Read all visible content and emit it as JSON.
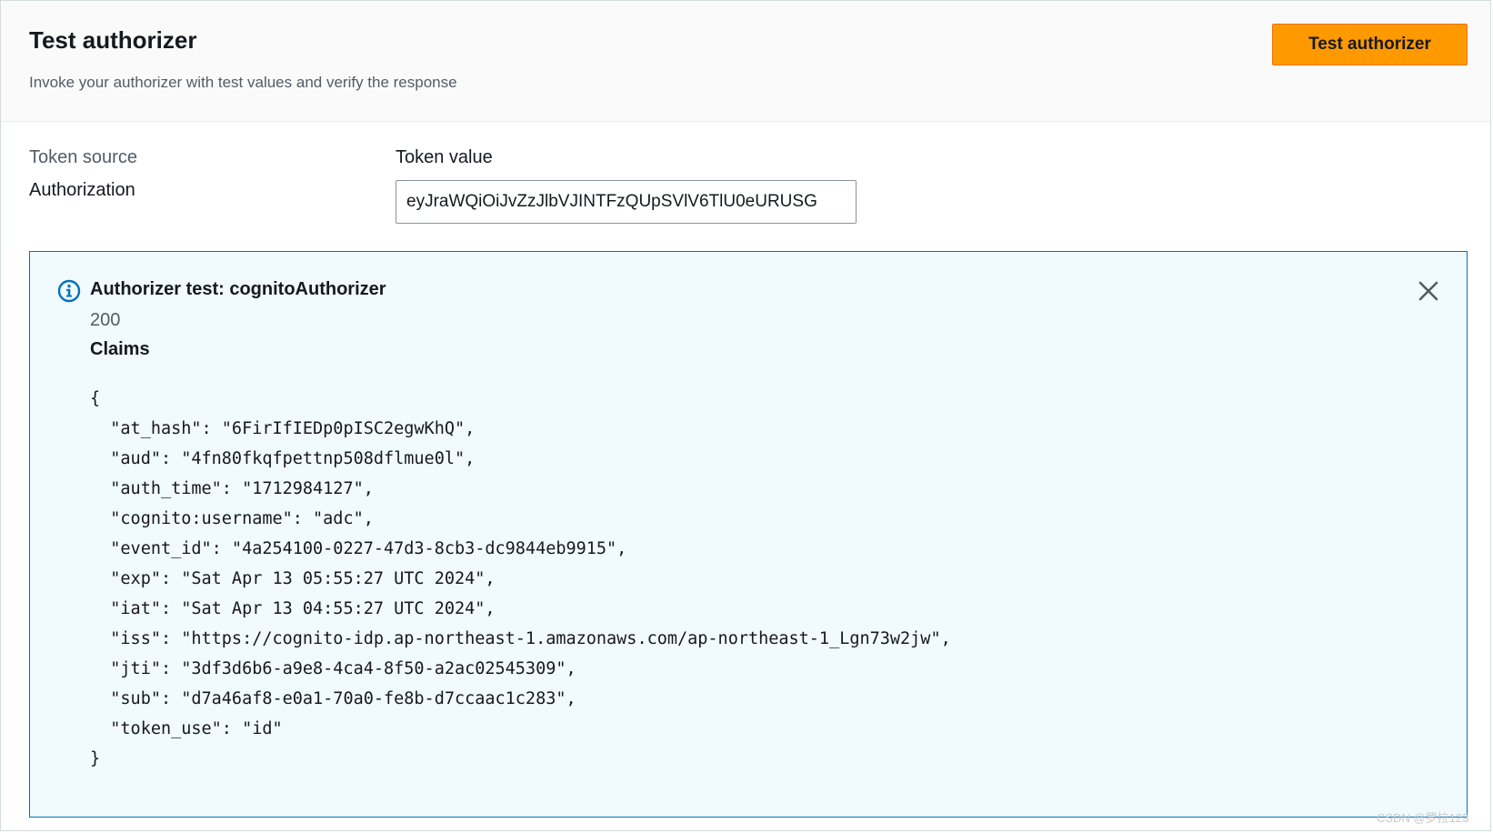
{
  "header": {
    "title": "Test authorizer",
    "subtitle": "Invoke your authorizer with test values and verify the response",
    "test_button_label": "Test authorizer"
  },
  "form": {
    "token_source_label": "Token source",
    "token_source_value": "Authorization",
    "token_value_label": "Token value",
    "token_value": "eyJraWQiOiJvZzJlbVJINTFzQUpSVlV6TlU0eURUSG"
  },
  "alert": {
    "icon": "info-icon",
    "title": "Authorizer test: cognitoAuthorizer",
    "status_code": "200",
    "claims_heading": "Claims",
    "claims_json": "{\n  \"at_hash\": \"6FirIfIEDp0pISC2egwKhQ\",\n  \"aud\": \"4fn80fkqfpettnp508dflmue0l\",\n  \"auth_time\": \"1712984127\",\n  \"cognito:username\": \"adc\",\n  \"event_id\": \"4a254100-0227-47d3-8cb3-dc9844eb9915\",\n  \"exp\": \"Sat Apr 13 05:55:27 UTC 2024\",\n  \"iat\": \"Sat Apr 13 04:55:27 UTC 2024\",\n  \"iss\": \"https://cognito-idp.ap-northeast-1.amazonaws.com/ap-northeast-1_Lgn73w2jw\",\n  \"jti\": \"3df3d6b6-a9e8-4ca4-8f50-a2ac02545309\",\n  \"sub\": \"d7a46af8-e0a1-70a0-fe8b-d7ccaac1c283\",\n  \"token_use\": \"id\"\n}",
    "close_icon": "close-icon"
  },
  "watermark": "CSDN @罗拉123",
  "colors": {
    "primary_button": "#ff9900",
    "alert_background": "#f1faff",
    "alert_border": "#0073bb",
    "info_icon": "#0073bb"
  }
}
